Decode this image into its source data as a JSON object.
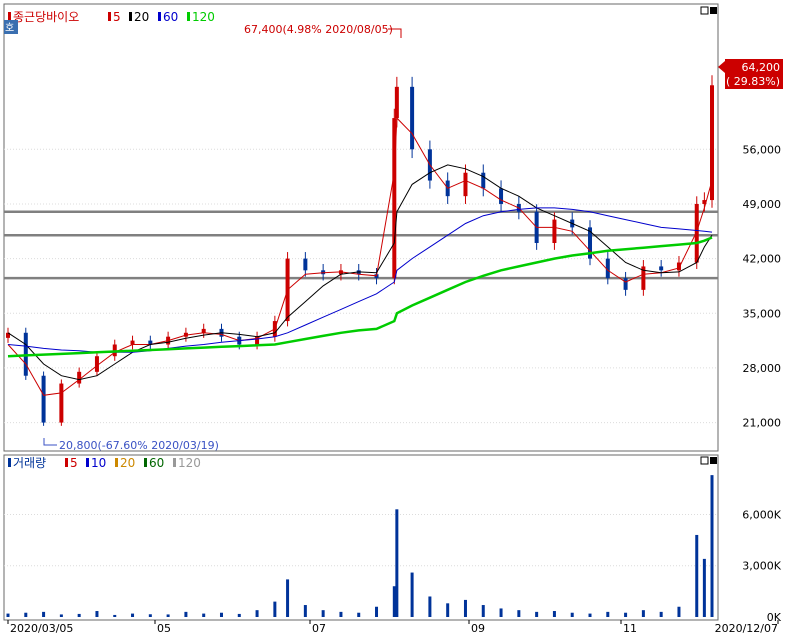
{
  "price_panel": {
    "legend_name": "종근당바이오",
    "ma_labels": [
      {
        "label": "5",
        "color": "#cc0000"
      },
      {
        "label": "20",
        "color": "#000000"
      },
      {
        "label": "60",
        "color": "#0000cc"
      },
      {
        "label": "120",
        "color": "#00cc00"
      }
    ],
    "side_tag": "호",
    "current_price": "64,200",
    "current_change": "( 29.83%)",
    "high_annotation": "67,400(4.98% 2020/08/05)",
    "low_annotation": "20,800(-67.60% 2020/03/19)"
  },
  "volume_panel": {
    "legend_name": "거래량",
    "ma_labels": [
      {
        "label": "5",
        "color": "#cc0000"
      },
      {
        "label": "10",
        "color": "#0000cc"
      },
      {
        "label": "20",
        "color": "#cc8800"
      },
      {
        "label": "60",
        "color": "#006600"
      },
      {
        "label": "120",
        "color": "#999999"
      }
    ]
  },
  "x_axis": {
    "labels": [
      "2020/03/05",
      "05",
      "07",
      "09",
      "11",
      "2020/12/07"
    ]
  },
  "colors": {
    "up": "#cc0000",
    "down": "#003399",
    "ma5": "#cc0000",
    "ma20": "#000000",
    "ma60": "#0000cc",
    "ma120": "#00cc00",
    "support_line": "#808080"
  },
  "chart_data": [
    {
      "type": "candlestick",
      "title": "종근당바이오",
      "x_range": [
        "2020/03/05",
        "2020/12/07"
      ],
      "y_tick_labels": [
        "56,000",
        "49,000",
        "42,000",
        "35,000",
        "28,000",
        "21,000"
      ],
      "y_ticks": [
        56000,
        49000,
        42000,
        35000,
        28000,
        21000
      ],
      "ylim": [
        18000,
        70000
      ],
      "horizontal_levels": [
        48000,
        45000,
        39500
      ],
      "close_series": [
        [
          "2020/03/05",
          32500
        ],
        [
          "2020/03/12",
          27000
        ],
        [
          "2020/03/19",
          21000
        ],
        [
          "2020/03/26",
          26000
        ],
        [
          "2020/04/02",
          27500
        ],
        [
          "2020/04/09",
          29500
        ],
        [
          "2020/04/16",
          31000
        ],
        [
          "2020/04/23",
          31500
        ],
        [
          "2020/04/30",
          31000
        ],
        [
          "2020/05/07",
          32000
        ],
        [
          "2020/05/14",
          32500
        ],
        [
          "2020/05/21",
          33000
        ],
        [
          "2020/05/28",
          32000
        ],
        [
          "2020/06/04",
          31000
        ],
        [
          "2020/06/11",
          32000
        ],
        [
          "2020/06/18",
          34000
        ],
        [
          "2020/06/23",
          42000
        ],
        [
          "2020/06/30",
          40500
        ],
        [
          "2020/07/07",
          40000
        ],
        [
          "2020/07/14",
          40500
        ],
        [
          "2020/07/21",
          40000
        ],
        [
          "2020/07/28",
          39500
        ],
        [
          "2020/08/04",
          60000
        ],
        [
          "2020/08/05",
          64000
        ],
        [
          "2020/08/11",
          56000
        ],
        [
          "2020/08/18",
          52000
        ],
        [
          "2020/08/25",
          50000
        ],
        [
          "2020/09/01",
          53000
        ],
        [
          "2020/09/08",
          51000
        ],
        [
          "2020/09/15",
          49000
        ],
        [
          "2020/09/22",
          48000
        ],
        [
          "2020/09/29",
          44000
        ],
        [
          "2020/10/06",
          47000
        ],
        [
          "2020/10/13",
          46000
        ],
        [
          "2020/10/20",
          42000
        ],
        [
          "2020/10/27",
          39500
        ],
        [
          "2020/11/03",
          38000
        ],
        [
          "2020/11/10",
          41000
        ],
        [
          "2020/11/17",
          40500
        ],
        [
          "2020/11/24",
          41500
        ],
        [
          "2020/12/01",
          49000
        ],
        [
          "2020/12/04",
          49500
        ],
        [
          "2020/12/07",
          64200
        ]
      ],
      "ma_series": [
        {
          "name": "5",
          "values": [
            31000,
            28500,
            24500,
            24800,
            26500,
            28300,
            30000,
            31000,
            31000,
            31500,
            32200,
            32500,
            32300,
            31500,
            31800,
            33000,
            38000,
            40000,
            40200,
            40300,
            40000,
            39800,
            53000,
            60000,
            58000,
            54000,
            51000,
            52000,
            51000,
            49500,
            48500,
            46000,
            46000,
            45500,
            43000,
            40500,
            39000,
            40000,
            40200,
            40800,
            45500,
            48500,
            52000
          ]
        },
        {
          "name": "20",
          "values": [
            32500,
            31000,
            28500,
            27000,
            26500,
            27000,
            28500,
            30000,
            31000,
            31300,
            31800,
            32200,
            32500,
            32300,
            32000,
            32500,
            34500,
            36500,
            38500,
            40000,
            40300,
            40200,
            44000,
            48000,
            51500,
            53000,
            54000,
            53500,
            52500,
            51000,
            50000,
            48500,
            47500,
            46500,
            45500,
            43500,
            41500,
            40500,
            40200,
            40300,
            41500,
            43500,
            45000
          ]
        },
        {
          "name": "60",
          "values": [
            31000,
            30800,
            30500,
            30300,
            30200,
            30000,
            30000,
            30000,
            30200,
            30500,
            30800,
            31000,
            31300,
            31500,
            31700,
            32000,
            32500,
            33500,
            34500,
            35500,
            36500,
            37500,
            39000,
            40500,
            42000,
            43500,
            45000,
            46500,
            47500,
            48000,
            48300,
            48500,
            48500,
            48300,
            48000,
            47500,
            47000,
            46500,
            46000,
            45800,
            45600,
            45500,
            45400
          ]
        },
        {
          "name": "120",
          "values": [
            29500,
            29600,
            29700,
            29800,
            29900,
            30000,
            30100,
            30200,
            30300,
            30400,
            30500,
            30600,
            30700,
            30800,
            30900,
            31000,
            31300,
            31700,
            32100,
            32500,
            32800,
            33000,
            34000,
            35000,
            36000,
            37000,
            38000,
            39000,
            39800,
            40500,
            41000,
            41500,
            42000,
            42400,
            42700,
            43000,
            43200,
            43400,
            43600,
            43800,
            44000,
            44300,
            44700
          ]
        }
      ]
    },
    {
      "type": "bar",
      "title": "거래량",
      "x_range": [
        "2020/03/05",
        "2020/12/07"
      ],
      "y_tick_labels": [
        "6,000K",
        "3,000K",
        "0K"
      ],
      "y_ticks": [
        6000,
        3000,
        0
      ],
      "ylim": [
        0,
        8600
      ],
      "unit": "K",
      "values": [
        [
          "2020/03/05",
          200
        ],
        [
          "2020/03/12",
          250
        ],
        [
          "2020/03/19",
          300
        ],
        [
          "2020/03/26",
          150
        ],
        [
          "2020/04/02",
          180
        ],
        [
          "2020/04/09",
          350
        ],
        [
          "2020/04/16",
          120
        ],
        [
          "2020/04/23",
          200
        ],
        [
          "2020/04/30",
          160
        ],
        [
          "2020/05/07",
          150
        ],
        [
          "2020/05/14",
          300
        ],
        [
          "2020/05/21",
          200
        ],
        [
          "2020/05/28",
          250
        ],
        [
          "2020/06/04",
          180
        ],
        [
          "2020/06/11",
          400
        ],
        [
          "2020/06/18",
          900
        ],
        [
          "2020/06/23",
          2200
        ],
        [
          "2020/06/30",
          700
        ],
        [
          "2020/07/07",
          400
        ],
        [
          "2020/07/14",
          300
        ],
        [
          "2020/07/21",
          250
        ],
        [
          "2020/07/28",
          600
        ],
        [
          "2020/08/04",
          1800
        ],
        [
          "2020/08/05",
          6300
        ],
        [
          "2020/08/11",
          2600
        ],
        [
          "2020/08/18",
          1200
        ],
        [
          "2020/08/25",
          800
        ],
        [
          "2020/09/01",
          1000
        ],
        [
          "2020/09/08",
          700
        ],
        [
          "2020/09/15",
          500
        ],
        [
          "2020/09/22",
          400
        ],
        [
          "2020/09/29",
          300
        ],
        [
          "2020/10/06",
          350
        ],
        [
          "2020/10/13",
          250
        ],
        [
          "2020/10/20",
          200
        ],
        [
          "2020/10/27",
          300
        ],
        [
          "2020/11/03",
          250
        ],
        [
          "2020/11/10",
          400
        ],
        [
          "2020/11/17",
          300
        ],
        [
          "2020/11/24",
          600
        ],
        [
          "2020/12/01",
          4800
        ],
        [
          "2020/12/04",
          3400
        ],
        [
          "2020/12/07",
          8300
        ]
      ]
    }
  ]
}
